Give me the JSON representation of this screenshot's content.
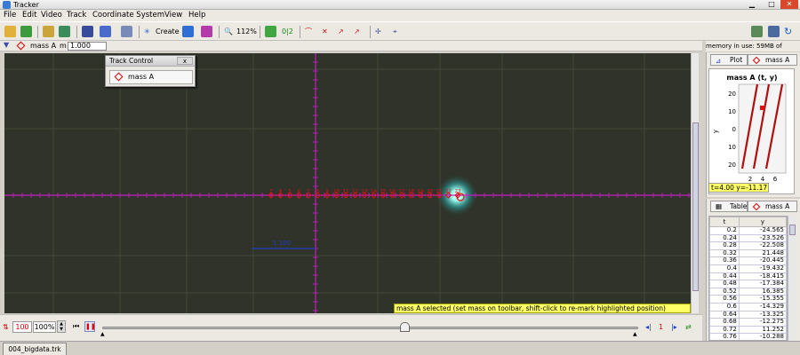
{
  "window": {
    "title": "Tracker"
  },
  "menu": [
    "File",
    "Edit",
    "Video",
    "Track",
    "Coordinate System",
    "View",
    "Help"
  ],
  "toolbar": {
    "create_label": "Create",
    "zoom_label": "112%",
    "toggle_label": "0|2"
  },
  "trackbar": {
    "track_name": "mass A",
    "mass_label": "m",
    "mass_value": "1.000"
  },
  "memory": {
    "text": "memory in use: 59MB of 844MB"
  },
  "track_control": {
    "title": "Track Control",
    "close_label": "x",
    "item_label": "mass A"
  },
  "video": {
    "point_labels": [
      "3",
      "4",
      "5",
      "6",
      "7",
      "8",
      "9",
      "10",
      "11",
      "12",
      "13",
      "14",
      "15",
      "16",
      "17",
      "18",
      "19",
      "20",
      "21",
      "22",
      "23"
    ],
    "calibration_label": "1.100"
  },
  "status": {
    "text": "mass A selected (set mass on toolbar, shift-click to re-mark highlighted position)"
  },
  "player": {
    "rate": "100",
    "zoom": "100%",
    "frame": "1"
  },
  "file_tab": {
    "label": "004_bigdata.trk"
  },
  "plot_panel": {
    "tab_plot": "Plot",
    "tab_track": "mass A",
    "title": "mass A (t, y)",
    "ylabel": "y",
    "yticks": [
      "20",
      "10",
      "0",
      "10",
      "20"
    ],
    "xticks": [
      "2",
      "4",
      "6"
    ],
    "readout": "t=4.00  y=-11.17"
  },
  "table_panel": {
    "tab_table": "Table",
    "tab_track": "mass A",
    "columns": [
      "t",
      "y"
    ],
    "rows": [
      [
        "0.2",
        "-24.565"
      ],
      [
        "0.24",
        "-23.526"
      ],
      [
        "0.28",
        "-22.508"
      ],
      [
        "0.32",
        "21.448"
      ],
      [
        "0.36",
        "-20.445"
      ],
      [
        "0.4",
        "-19.432"
      ],
      [
        "0.44",
        "-18.415"
      ],
      [
        "0.48",
        "-17.384"
      ],
      [
        "0.52",
        "16.385"
      ],
      [
        "0.56",
        "-15.355"
      ],
      [
        "0.6",
        "-14.329"
      ],
      [
        "0.64",
        "-13.325"
      ],
      [
        "0.68",
        "-12.275"
      ],
      [
        "0.72",
        "11.252"
      ],
      [
        "0.76",
        "-10.288"
      ]
    ]
  },
  "colors": {
    "axis": "#c020c0",
    "track": "#e01010",
    "calibration": "#2040c0",
    "highlight": "#ffff66"
  }
}
